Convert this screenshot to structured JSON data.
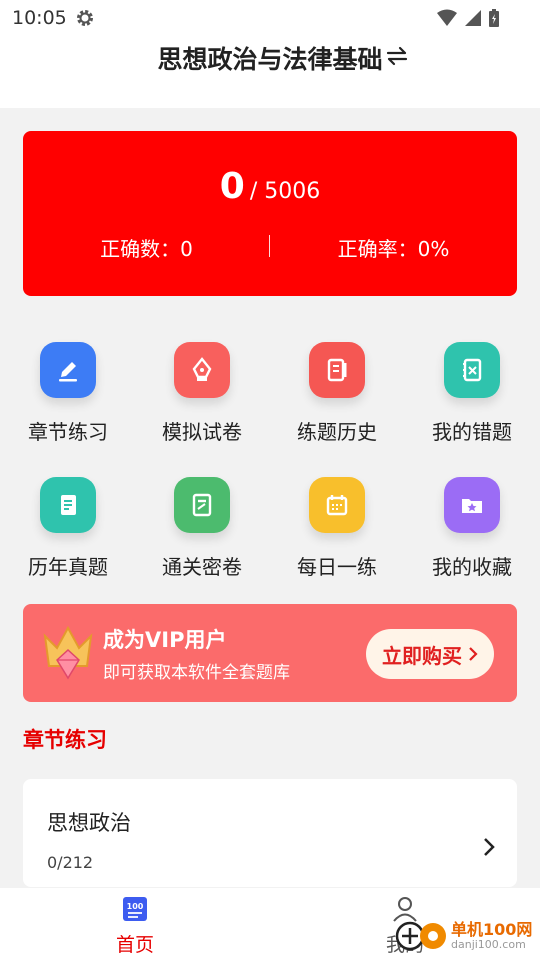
{
  "status": {
    "time": "10:05"
  },
  "header": {
    "title": "思想政治与法律基础"
  },
  "score": {
    "answered": "0",
    "total": "/ 5006",
    "correct_label": "正确数：0",
    "rate_label": "正确率：0%"
  },
  "menu": [
    {
      "label": "章节练习",
      "icon": "edit-list-icon",
      "color": "#3d7cf5"
    },
    {
      "label": "模拟试卷",
      "icon": "pen-nib-icon",
      "color": "#f8605d"
    },
    {
      "label": "练题历史",
      "icon": "notebook-pen-icon",
      "color": "#f55753"
    },
    {
      "label": "我的错题",
      "icon": "wrong-book-icon",
      "color": "#2fc3ad"
    },
    {
      "label": "历年真题",
      "icon": "document-icon",
      "color": "#2fc3ad"
    },
    {
      "label": "通关密卷",
      "icon": "score-paper-icon",
      "color": "#4cbb6e"
    },
    {
      "label": "每日一练",
      "icon": "calendar-icon",
      "color": "#f8bf2c"
    },
    {
      "label": "我的收藏",
      "icon": "star-folder-icon",
      "color": "#9b6cf5"
    }
  ],
  "vip": {
    "title": "成为VIP用户",
    "subtitle": "即可获取本软件全套题库",
    "button": "立即购买"
  },
  "section": {
    "title": "章节练习"
  },
  "chapter": {
    "name": "思想政治",
    "progress": "0/212"
  },
  "nav": {
    "home": "首页",
    "me": "我的"
  },
  "watermark": {
    "name": "单机100网",
    "url": "danji100.com"
  },
  "colors": {
    "accent": "#ff0000",
    "banner": "#fb6b6b"
  }
}
